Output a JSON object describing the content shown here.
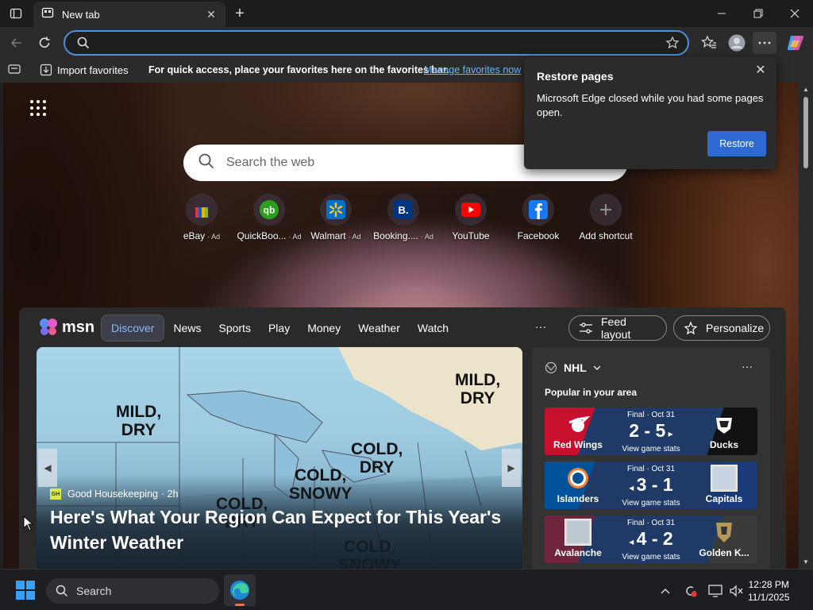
{
  "browser": {
    "tab": {
      "title": "New tab"
    },
    "address_bar": {
      "value": "",
      "placeholder": ""
    }
  },
  "favorites_bar": {
    "import_label": "Import favorites",
    "message": "For quick access, place your favorites here on the favorites bar.",
    "manage_link": "Manage favorites now"
  },
  "restore_popup": {
    "title": "Restore pages",
    "message": "Microsoft Edge closed while you had some pages open.",
    "button": "Restore"
  },
  "search": {
    "placeholder": "Search the web"
  },
  "shortcuts": [
    {
      "label": "eBay",
      "ad": "· Ad",
      "icon": "ebay-icon"
    },
    {
      "label": "QuickBoo...",
      "ad": "· Ad",
      "icon": "quickbooks-icon"
    },
    {
      "label": "Walmart",
      "ad": "· Ad",
      "icon": "walmart-icon"
    },
    {
      "label": "Booking....",
      "ad": "· Ad",
      "icon": "booking-icon"
    },
    {
      "label": "YouTube",
      "ad": "",
      "icon": "youtube-icon"
    },
    {
      "label": "Facebook",
      "ad": "",
      "icon": "facebook-icon"
    },
    {
      "label": "Add shortcut",
      "ad": "",
      "icon": "plus-icon"
    }
  ],
  "msn": {
    "logo": "msn",
    "nav": [
      "Discover",
      "News",
      "Sports",
      "Play",
      "Money",
      "Weather",
      "Watch"
    ],
    "more": "···",
    "feed_layout": "Feed layout",
    "personalize": "Personalize",
    "hero": {
      "map_labels": [
        "MILD,\nDRY",
        "MILD,\nDRY",
        "COLD,\nDRY",
        "COLD,\nSNOWY",
        "COLD,\nDRY",
        "COLD,\nSNOWY"
      ],
      "source_badge": "GH",
      "source": "Good Housekeeping",
      "age": "· 2h",
      "headline": "Here's What Your Region Can Expect for This Year's Winter Weather"
    },
    "nhl": {
      "league": "NHL",
      "more": "···",
      "subtitle": "Popular in your area",
      "games": [
        {
          "home": "Red Wings",
          "away": "Ducks",
          "status": "Final · Oct 31",
          "score": "2 - 5",
          "stats": "View game stats",
          "winner": "away",
          "home_color": "#c8102e",
          "away_color": "#111111"
        },
        {
          "home": "Islanders",
          "away": "Capitals",
          "status": "Final · Oct 31",
          "score": "3 - 1",
          "stats": "View game stats",
          "winner": "home",
          "home_color": "#00539b",
          "away_color": "#1b3a7a"
        },
        {
          "home": "Avalanche",
          "away": "Golden K...",
          "status": "Final · Oct 31",
          "score": "4 - 2",
          "stats": "View game stats",
          "winner": "home",
          "home_color": "#6f263d",
          "away_color": "#3a3a3a"
        }
      ]
    }
  },
  "taskbar": {
    "search_label": "Search",
    "time": "12:28 PM",
    "date": "11/1/2025"
  },
  "colors": {
    "accent": "#2f6ad4",
    "address_focus": "#4d8fe0",
    "link": "#6cb4ff"
  }
}
